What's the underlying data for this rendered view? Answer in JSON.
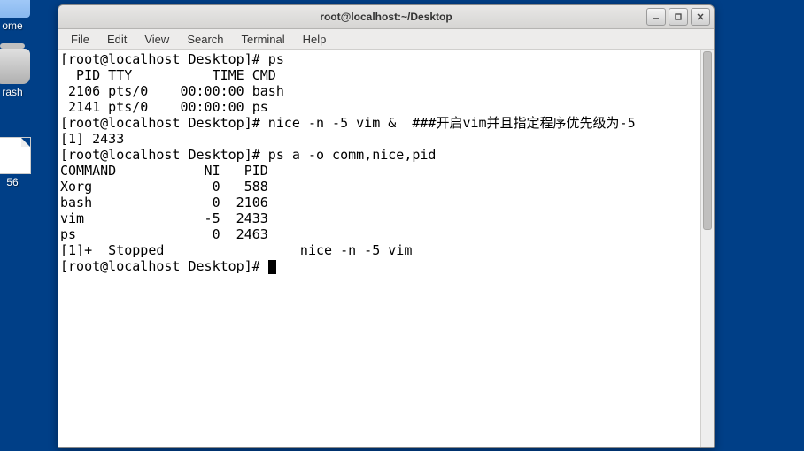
{
  "desktop": {
    "icons": [
      {
        "label": "ome",
        "kind": "folder"
      },
      {
        "label": "rash",
        "kind": "trash"
      },
      {
        "label": "56",
        "kind": "file"
      }
    ]
  },
  "window": {
    "title": "root@localhost:~/Desktop",
    "controls": {
      "minimize": "–",
      "maximize": "□",
      "close": "×"
    }
  },
  "menubar": [
    "File",
    "Edit",
    "View",
    "Search",
    "Terminal",
    "Help"
  ],
  "terminal": {
    "prompt": "[root@localhost Desktop]# ",
    "lines": [
      "[root@localhost Desktop]# ps",
      "  PID TTY          TIME CMD",
      " 2106 pts/0    00:00:00 bash",
      " 2141 pts/0    00:00:00 ps",
      "[root@localhost Desktop]# nice -n -5 vim &  ###开启vim并且指定程序优先级为-5",
      "[1] 2433",
      "[root@localhost Desktop]# ps a -o comm,nice,pid",
      "COMMAND           NI   PID",
      "Xorg               0   588",
      "bash               0  2106",
      "vim               -5  2433",
      "ps                 0  2463",
      "",
      "[1]+  Stopped                 nice -n -5 vim",
      "[root@localhost Desktop]# "
    ],
    "ps1": {
      "header": [
        "PID",
        "TTY",
        "TIME",
        "CMD"
      ],
      "rows": [
        {
          "PID": 2106,
          "TTY": "pts/0",
          "TIME": "00:00:00",
          "CMD": "bash"
        },
        {
          "PID": 2141,
          "TTY": "pts/0",
          "TIME": "00:00:00",
          "CMD": "ps"
        }
      ]
    },
    "nice_cmd": {
      "command": "nice -n -5 vim &",
      "comment": "###开启vim并且指定程序优先级为-5",
      "job": "[1] 2433"
    },
    "ps2": {
      "header": [
        "COMMAND",
        "NI",
        "PID"
      ],
      "rows": [
        {
          "COMMAND": "Xorg",
          "NI": 0,
          "PID": 588
        },
        {
          "COMMAND": "bash",
          "NI": 0,
          "PID": 2106
        },
        {
          "COMMAND": "vim",
          "NI": -5,
          "PID": 2433
        },
        {
          "COMMAND": "ps",
          "NI": 0,
          "PID": 2463
        }
      ]
    },
    "stopped_job": "[1]+  Stopped                 nice -n -5 vim"
  }
}
